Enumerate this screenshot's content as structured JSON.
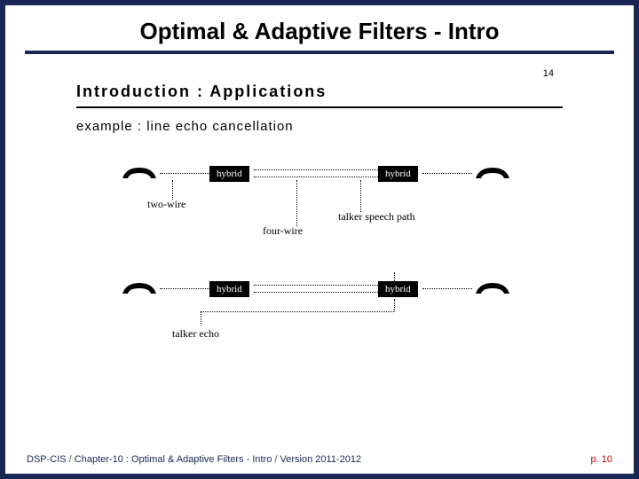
{
  "slide": {
    "title": "Optimal & Adaptive Filters - Intro",
    "inner": {
      "page_num": "14",
      "heading": "Introduction : Applications",
      "subheading": "example : line echo cancellation",
      "labels": {
        "hybrid1": "hybrid",
        "hybrid2": "hybrid",
        "hybrid3": "hybrid",
        "hybrid4": "hybrid",
        "two_wire": "two-wire",
        "four_wire": "four-wire",
        "talker_speech": "talker speech path",
        "talker_echo": "talker echo"
      }
    },
    "footer": {
      "course": "DSP-CIS",
      "chapter": "Chapter-10 : Optimal & Adaptive Filters - Intro",
      "version": "Version 2011-2012",
      "sep": " / ",
      "page": "p. 10"
    }
  }
}
